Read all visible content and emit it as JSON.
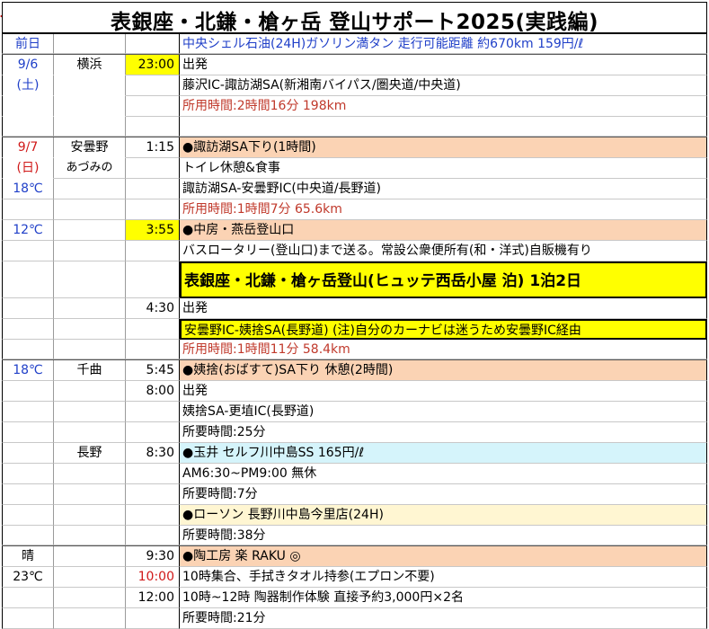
{
  "title": "表銀座・北鎌・槍ヶ岳 登山サポート2025(実践編)",
  "header": {
    "day": "前日",
    "note": "中央シェル石油(24H)ガソリン満タン 走行可能距離 約670km 159円/ℓ"
  },
  "rows": [
    {
      "day": "9/6",
      "place": "横浜",
      "time": "23:00",
      "text": "出発"
    },
    {
      "day": "(土)",
      "place": "",
      "time": "",
      "text": "藤沢IC-諏訪湖SA(新湘南バイパス/圏央道/中央道)"
    },
    {
      "day": "",
      "place": "",
      "time": "",
      "text": "所用時間:2時間16分 198km"
    },
    {
      "day": "",
      "place": "",
      "time": "",
      "text": ""
    },
    {
      "day": "9/7",
      "place": "安曇野",
      "time": "1:15",
      "text": "●諏訪湖SA下り(1時間)"
    },
    {
      "day": "(日)",
      "place": "あづみの",
      "time": "",
      "text": "トイレ休憩&食事"
    },
    {
      "day": "18℃",
      "place": "",
      "time": "",
      "text": "諏訪湖SA-安曇野IC(中央道/長野道)"
    },
    {
      "day": "",
      "place": "",
      "time": "",
      "text": "所用時間:1時間7分 65.6km"
    },
    {
      "day": "12℃",
      "place": "",
      "time": "3:55",
      "text": "●中房・燕岳登山口"
    },
    {
      "day": "",
      "place": "",
      "time": "",
      "text": "バスロータリー(登山口)まで送る。常設公衆便所有(和・洋式)自販機有り"
    },
    {
      "day": "",
      "place": "",
      "time": "",
      "text": "表銀座・北鎌・槍ヶ岳登山(ヒュッテ西岳小屋 泊) 1泊2日"
    },
    {
      "day": "",
      "place": "",
      "time": "4:30",
      "text": "出発"
    },
    {
      "day": "",
      "place": "",
      "time": "",
      "text": "安曇野IC-姨捨SA(長野道) (注)自分のカーナビは迷うため安曇野IC経由"
    },
    {
      "day": "",
      "place": "",
      "time": "",
      "text": "所用時間:1時間11分 58.4km"
    },
    {
      "day": "18℃",
      "place": "千曲",
      "time": "5:45",
      "text": "●姨捨(おばすて)SA下り 休憩(2時間)"
    },
    {
      "day": "",
      "place": "",
      "time": "8:00",
      "text": "出発"
    },
    {
      "day": "",
      "place": "",
      "time": "",
      "text": "姨捨SA-更埴IC(長野道)"
    },
    {
      "day": "",
      "place": "",
      "time": "",
      "text": "所要時間:25分"
    },
    {
      "day": "",
      "place": "長野",
      "time": "8:30",
      "text": "●玉井 セルフ川中島SS 165円/ℓ"
    },
    {
      "day": "",
      "place": "",
      "time": "",
      "text": "AM6:30~PM9:00 無休"
    },
    {
      "day": "",
      "place": "",
      "time": "",
      "text": "所要時間:7分"
    },
    {
      "day": "",
      "place": "",
      "time": "",
      "text": "●ローソン 長野川中島今里店(24H)"
    },
    {
      "day": "",
      "place": "",
      "time": "",
      "text": "所要時間:38分"
    },
    {
      "day": "晴",
      "place": "",
      "time": "9:30",
      "text": "●陶工房 楽 RAKU ◎"
    },
    {
      "day": "23℃",
      "place": "",
      "time": "10:00",
      "text": "10時集合、手拭きタオル持参(エプロン不要)"
    },
    {
      "day": "",
      "place": "",
      "time": "12:00",
      "text": "10時~12時 陶器制作体験 直接予約3,000円×2名"
    },
    {
      "day": "",
      "place": "",
      "time": "",
      "text": "所要時間:21分"
    }
  ]
}
